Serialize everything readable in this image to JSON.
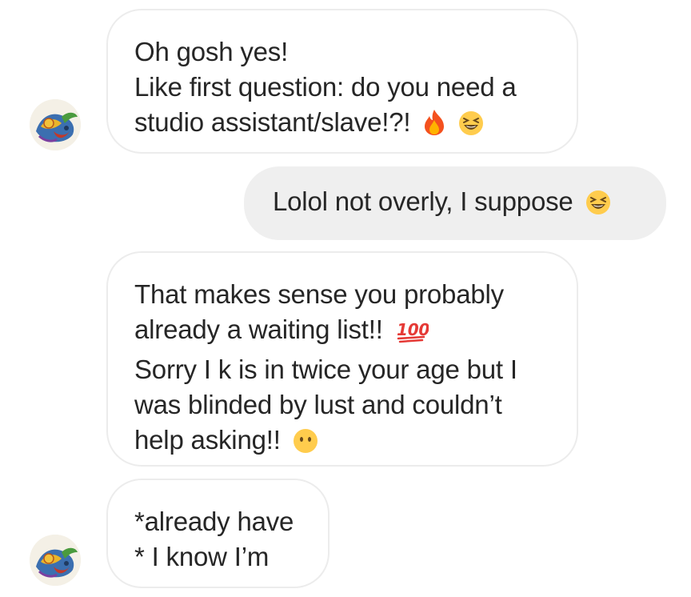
{
  "thread": {
    "messages": [
      {
        "direction": "incoming",
        "lines": [
          "Oh gosh yes!",
          "Like first question: do you need a",
          "studio assistant/slave!?!"
        ],
        "emojis": [
          "fire-emoji",
          "laughing-emoji"
        ]
      },
      {
        "direction": "outgoing",
        "lines": [
          "Lolol not overly, I suppose"
        ],
        "emojis": [
          "laughing-emoji"
        ]
      },
      {
        "direction": "incoming",
        "lines": [
          "That makes sense you probably",
          "already a waiting list!!",
          "Sorry I k is in twice your age but I",
          "was blinded by lust and couldn’t",
          "help asking!!"
        ],
        "emojis": [
          "hundred-points-emoji",
          "no-mouth-emoji"
        ]
      },
      {
        "direction": "incoming",
        "lines": [
          "*already have",
          "* I know I’m"
        ],
        "emojis": []
      }
    ]
  },
  "colors": {
    "incoming_bubble": "#ffffff",
    "incoming_border": "#ececec",
    "outgoing_bubble": "#efefef",
    "text": "#262626"
  }
}
